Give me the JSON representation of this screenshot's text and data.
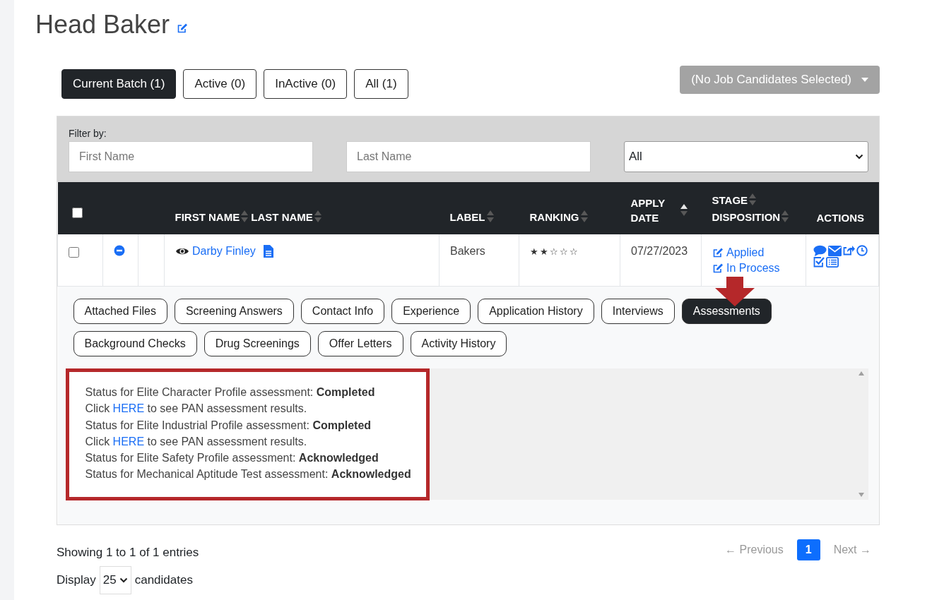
{
  "page_title": "Head Baker",
  "batch_tabs": [
    {
      "label": "Current Batch (1)",
      "selected": true
    },
    {
      "label": "Active (0)",
      "selected": false
    },
    {
      "label": "InActive (0)",
      "selected": false
    },
    {
      "label": "All (1)",
      "selected": false
    }
  ],
  "bulk_action": {
    "label": "(No Job Candidates Selected)",
    "disabled": true
  },
  "filter": {
    "label": "Filter by:",
    "first_name": {
      "placeholder": "First Name"
    },
    "last_name": {
      "placeholder": "Last Name"
    },
    "status": {
      "value": "All"
    }
  },
  "table": {
    "select_all": {
      "checked": false
    },
    "columns": [
      {
        "label": "FIRST NAME",
        "sortable": true,
        "sorted": false
      },
      {
        "label": "LAST NAME",
        "sortable": true,
        "sorted": false
      },
      {
        "label": "LABEL",
        "sortable": true,
        "sorted": false
      },
      {
        "label": "RANKING",
        "sortable": true,
        "sorted": false
      },
      {
        "label": "APPLY DATE",
        "sortable": true,
        "sorted": true
      },
      {
        "label": "STAGE",
        "sortable": true,
        "sorted": false
      },
      {
        "label": "DISPOSITION",
        "sortable": true,
        "sorted": false
      },
      {
        "label": "ACTIONS",
        "sortable": false
      }
    ],
    "rows": [
      {
        "checked": false,
        "expanded": true,
        "name": "Darby Finley",
        "label": "Bakers",
        "stars": 2,
        "apply_date": "07/27/2023",
        "stage": "Applied",
        "disposition": "In Process"
      }
    ]
  },
  "detail_tabs": [
    {
      "label": "Attached Files",
      "selected": false
    },
    {
      "label": "Screening Answers",
      "selected": false
    },
    {
      "label": "Contact Info",
      "selected": false
    },
    {
      "label": "Experience",
      "selected": false
    },
    {
      "label": "Application History",
      "selected": false
    },
    {
      "label": "Interviews",
      "selected": false
    },
    {
      "label": "Assessments",
      "selected": true
    },
    {
      "label": "Background Checks",
      "selected": false
    },
    {
      "label": "Drug Screenings",
      "selected": false
    },
    {
      "label": "Offer Letters",
      "selected": false
    },
    {
      "label": "Activity History",
      "selected": false
    }
  ],
  "assessments": [
    {
      "kind": "status",
      "text": "Status for Elite Character Profile assessment: **Completed**"
    },
    {
      "kind": "link",
      "before": "Click ",
      "link": "HERE",
      "after": " to see PAN assessment results."
    },
    {
      "kind": "status",
      "text": "Status for Elite Industrial Profile assessment: **Completed**"
    },
    {
      "kind": "link",
      "before": "Click ",
      "link": "HERE",
      "after": " to see PAN assessment results."
    },
    {
      "kind": "status",
      "text": "Status for Elite Safety Profile assessment: **Acknowledged**"
    },
    {
      "kind": "status",
      "text": "Status for Mechanical Aptitude Test assessment: **Acknowledged**"
    }
  ],
  "footer": {
    "info": "Showing 1 to 1 of 1 entries",
    "display_label": "Display",
    "page_size": "25",
    "display_suffix": "candidates"
  },
  "pagination": {
    "previous": {
      "label": "← Previous",
      "disabled": true
    },
    "pages": [
      {
        "label": "1",
        "selected": true
      }
    ],
    "next": {
      "label": "Next →",
      "disabled": true
    }
  }
}
